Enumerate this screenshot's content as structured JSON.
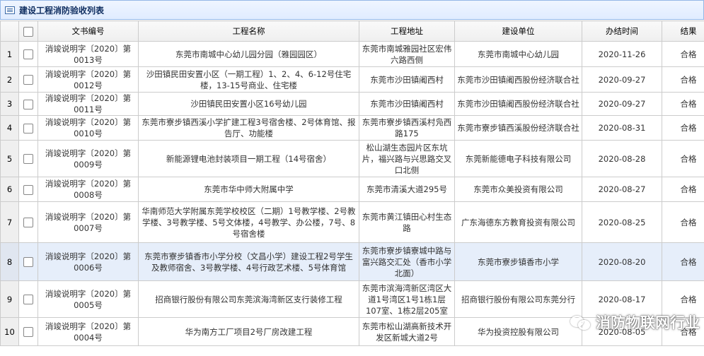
{
  "panel": {
    "title": "建设工程消防验收列表",
    "icon": "list-icon"
  },
  "columns": {
    "doc_no": "文书编号",
    "name": "工程名称",
    "address": "工程地址",
    "unit": "建设单位",
    "date": "办结时间",
    "result": "结果"
  },
  "rows": [
    {
      "num": "1",
      "doc_no": "消竣说明字〔2020〕第0013号",
      "name": "东莞市南城中心幼儿园分园（雅园园区）",
      "address": "东莞市南城雅园社区宏伟六路西侧",
      "unit": "东莞市南城中心幼儿园",
      "date": "2020-11-26",
      "result": "合格"
    },
    {
      "num": "2",
      "doc_no": "消竣说明字〔2020〕第0012号",
      "name": "沙田镇民田安置小区（一期工程）1、2、4、6-12号住宅楼，13-15号商业、住宅楼",
      "address": "东莞市沙田镇阇西村",
      "unit": "东莞市沙田镇阇西股份经济联合社",
      "date": "2020-09-27",
      "result": "合格"
    },
    {
      "num": "3",
      "doc_no": "消竣说明字〔2020〕第0011号",
      "name": "沙田镇民田安置小区16号幼儿园",
      "address": "东莞市沙田镇阇西村",
      "unit": "东莞市沙田镇阇西股份经济联合社",
      "date": "2020-09-27",
      "result": "合格"
    },
    {
      "num": "4",
      "doc_no": "消竣说明字〔2020〕第0010号",
      "name": "东莞市寮步镇西溪小学扩建工程3号宿舍楼、2号体育馆、报告厅、功能楼",
      "address": "东莞市寮步镇西溪村凫西路175",
      "unit": "东莞市寮步镇西溪股份经济联合社",
      "date": "2020-08-31",
      "result": "合格"
    },
    {
      "num": "5",
      "doc_no": "消竣说明字〔2020〕第0009号",
      "name": "新能源锂电池封装项目一期工程（14号宿舍）",
      "address": "松山湖生态园片区东坑片，福兴路与兴思路交叉口北侧",
      "unit": "东莞新能德电子科技有限公司",
      "date": "2020-08-28",
      "result": "合格"
    },
    {
      "num": "6",
      "doc_no": "消竣说明字〔2020〕第0008号",
      "name": "东莞市华中师大附属中学",
      "address": "东莞市清溪大道295号",
      "unit": "东莞市众美投资有限公司",
      "date": "2020-08-27",
      "result": "合格"
    },
    {
      "num": "7",
      "doc_no": "消竣说明字〔2020〕第0007号",
      "name": "华南师范大学附属东莞学校校区（二期）1号教学楼、2号教学楼、3号教学楼、5号文体楼，4号教学、办公楼，7号、8号宿舍楼",
      "address": "东莞市黄江镇田心村生态路",
      "unit": "广东海德东方教育投资有限公司",
      "date": "2020-08-25",
      "result": "合格"
    },
    {
      "num": "8",
      "doc_no": "消竣说明字〔2020〕第0006号",
      "name": "东莞市寮步镇香市小学分校（文昌小学）建设工程2号学生及教师宿舍、3号教学楼、4号行政艺术楼、5号体育馆",
      "address": "东莞市寮步镇寮城中路与富兴路交汇处（香市小学北面）",
      "unit": "东莞市寮步镇香市小学",
      "date": "2020-08-20",
      "result": "合格"
    },
    {
      "num": "9",
      "doc_no": "消竣说明字〔2020〕第0005号",
      "name": "招商银行股份有限公司东莞滨海湾新区支行装修工程",
      "address": "东莞市滨海湾新区湾区大道1号湾区1号1栋1层107室、1栋2层205室",
      "unit": "招商银行股份有限公司东莞分行",
      "date": "2020-08-17",
      "result": "合格"
    },
    {
      "num": "10",
      "doc_no": "消竣说明字〔2020〕第0004号",
      "name": "华为南方工厂项目2号厂房改建工程",
      "address": "东莞市松山湖高新技术开发区新城大道2号",
      "unit": "华为投资控股有限公司",
      "date": "2020-08-05",
      "result": "合格"
    }
  ],
  "watermark": {
    "text": "消防物联网行业",
    "icon": "wechat-icon"
  }
}
